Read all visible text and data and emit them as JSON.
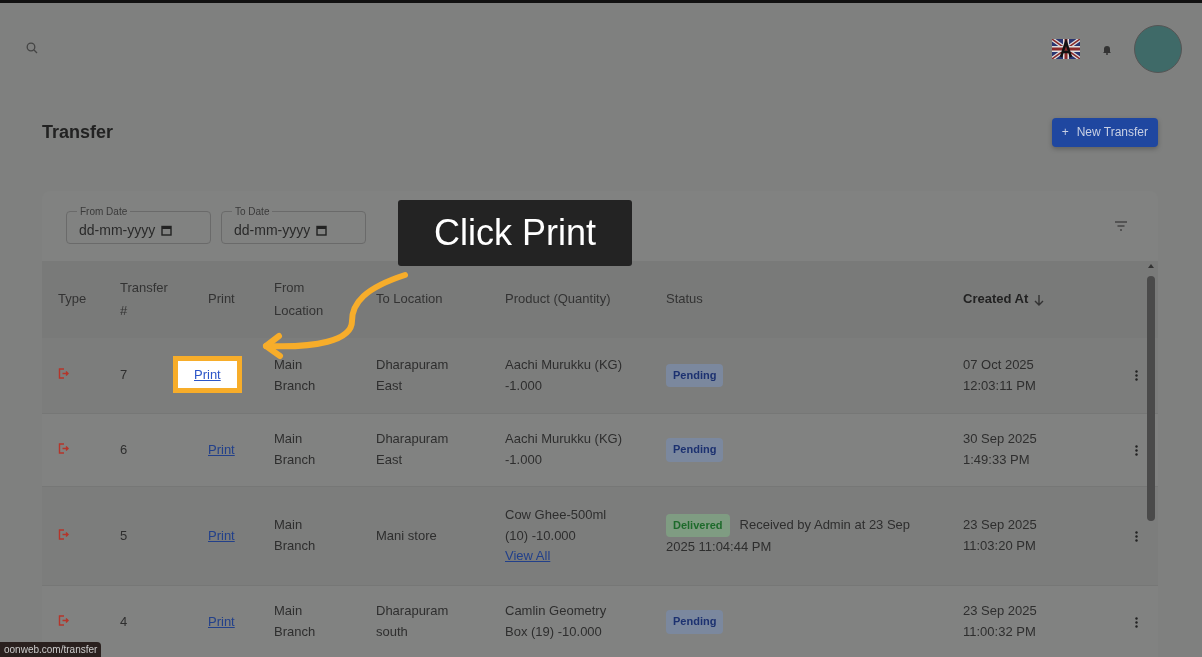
{
  "page": {
    "title": "Transfer",
    "new_button": {
      "icon": "+",
      "label": "New Transfer"
    }
  },
  "filters": [
    {
      "label": "From Date",
      "placeholder": "dd-mm-yyyy"
    },
    {
      "label": "To Date",
      "placeholder": "dd-mm-yyyy"
    }
  ],
  "table": {
    "columns": [
      {
        "label": "Type",
        "sorted": false
      },
      {
        "label": "Transfer #",
        "sorted": false
      },
      {
        "label": "Print",
        "sorted": false
      },
      {
        "label": "From Location",
        "sorted": false
      },
      {
        "label": "To Location",
        "sorted": false
      },
      {
        "label": "Product (Quantity)",
        "sorted": false
      },
      {
        "label": "Status",
        "sorted": false
      },
      {
        "label": "Created At",
        "sorted": true
      }
    ],
    "rows": [
      {
        "number": "7",
        "print": "Print",
        "print_highlighted": true,
        "from": "Main Branch",
        "to": "Dharapuram East",
        "product": "Aachi Murukku (KG) -1.000",
        "status": {
          "kind": "pending",
          "label": "Pending"
        },
        "date": "07 Oct 2025",
        "time": "12:03:11 PM"
      },
      {
        "number": "6",
        "print": "Print",
        "print_highlighted": false,
        "from": "Main Branch",
        "to": "Dharapuram East",
        "product": "Aachi Murukku (KG) -1.000",
        "status": {
          "kind": "pending",
          "label": "Pending"
        },
        "date": "30 Sep 2025",
        "time": "1:49:33 PM"
      },
      {
        "number": "5",
        "print": "Print",
        "print_highlighted": false,
        "from": "Main Branch",
        "to": "Mani store",
        "product": "Cow Ghee-500ml (10) -10.000",
        "view_all": "View All",
        "status": {
          "kind": "delivered",
          "label": "Delivered",
          "note": "Received by Admin at 23 Sep 2025 11:04:44 PM"
        },
        "date": "23 Sep 2025",
        "time": "11:03:20 PM"
      },
      {
        "number": "4",
        "print": "Print",
        "print_highlighted": false,
        "from": "Main Branch",
        "to": "Dharapuram south",
        "product": "Camlin Geometry Box (19) -10.000",
        "status": {
          "kind": "pending",
          "label": "Pending"
        },
        "date": "23 Sep 2025",
        "time": "11:00:32 PM"
      }
    ]
  },
  "callout": {
    "text": "Click Print"
  },
  "status_bar": {
    "url": "oonweb.com/transfer"
  }
}
